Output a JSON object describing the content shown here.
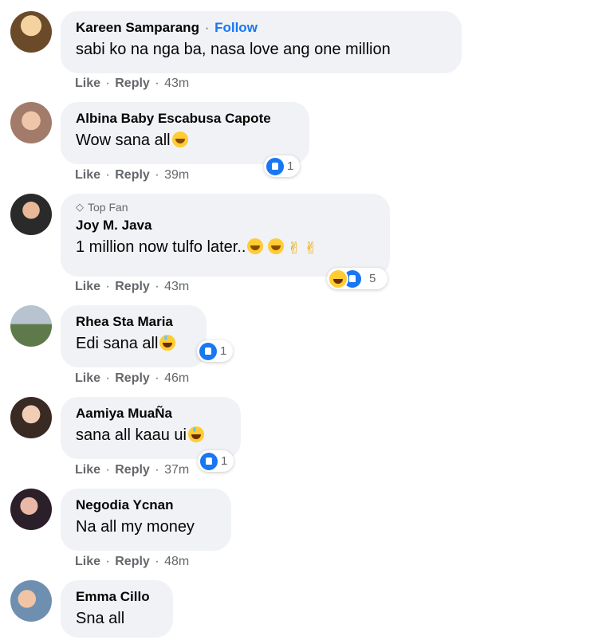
{
  "comments": [
    {
      "name": "Kareen Samparang",
      "follow": "Follow",
      "text": "sabi ko na nga ba, nasa love ang one million",
      "like": "Like",
      "reply": "Reply",
      "time": "43m"
    },
    {
      "name": "Albina Baby Escabusa Capote",
      "text": "Wow sana all",
      "like": "Like",
      "reply": "Reply",
      "time": "39m",
      "reactions": "1"
    },
    {
      "badge": "Top Fan",
      "name": "Joy M. Java",
      "text": "1 million now tulfo later..",
      "like": "Like",
      "reply": "Reply",
      "time": "43m",
      "reactions": "5"
    },
    {
      "name": "Rhea Sta Maria",
      "text": "Edi sana all",
      "like": "Like",
      "reply": "Reply",
      "time": "46m",
      "reactions": "1"
    },
    {
      "name": "Aamiya MuaÑa",
      "text": "sana all kaau ui",
      "like": "Like",
      "reply": "Reply",
      "time": "37m",
      "reactions": "1"
    },
    {
      "name": "Negodia Ycnan",
      "text": "Na all my money",
      "like": "Like",
      "reply": "Reply",
      "time": "48m"
    },
    {
      "name": "Emma Cillo",
      "text": "Sna all"
    }
  ],
  "separator": "·",
  "colors": {
    "link": "#1877f2",
    "bubble": "#f0f2f5",
    "muted": "#65676b"
  }
}
